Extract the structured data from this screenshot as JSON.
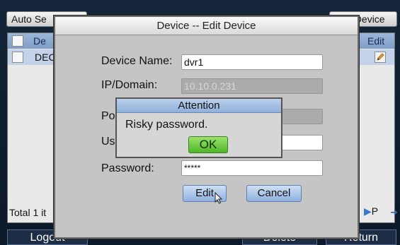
{
  "background": {
    "auto_search_label": "Auto Se",
    "add_device_label": "Add Device",
    "columns": {
      "device": "De",
      "edit": "Edit"
    },
    "row": {
      "text": "DEC"
    },
    "total_text": "Total 1 it",
    "page_label": "P",
    "bottom": {
      "logout": "Logout",
      "delete": "Delete",
      "return": "Return"
    }
  },
  "dialog": {
    "title": "Device -- Edit Device",
    "fields": {
      "device_name": {
        "label": "Device Name:",
        "value": "dvr1"
      },
      "ip_domain": {
        "label": "IP/Domain:",
        "value": "10.10.0.231"
      },
      "port": {
        "label": "Po",
        "value": ""
      },
      "user": {
        "label": "Us",
        "value": ""
      },
      "password": {
        "label": "Password:",
        "value": "*****"
      }
    },
    "edit_label": "Edit",
    "cancel_label": "Cancel"
  },
  "alert": {
    "title": "Attention",
    "message": "Risky password.",
    "ok_label": "OK"
  },
  "colors": {
    "dialog_bg": "#c5c5c5",
    "header_blue": "#8fb0db",
    "ok_green": "#4fb62a",
    "screen_bg": "#0b1929"
  }
}
